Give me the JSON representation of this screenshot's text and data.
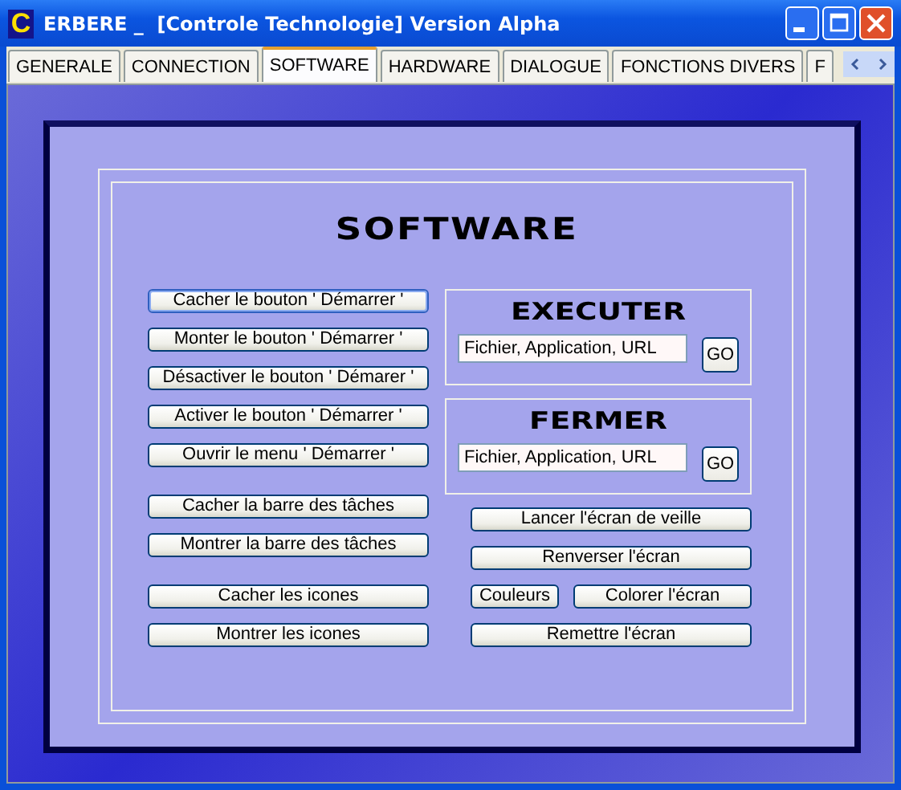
{
  "window": {
    "icon_letter": "C",
    "title": "ERBERE _  [Controle Technologie] Version Alpha"
  },
  "tabs": [
    {
      "label": "GENERALE",
      "selected": false
    },
    {
      "label": "CONNECTION",
      "selected": false
    },
    {
      "label": "SOFTWARE",
      "selected": true
    },
    {
      "label": "HARDWARE",
      "selected": false
    },
    {
      "label": "DIALOGUE",
      "selected": false
    },
    {
      "label": "FONCTIONS DIVERS",
      "selected": false
    },
    {
      "label": "F",
      "selected": false
    }
  ],
  "page": {
    "heading": "SOFTWARE",
    "left_groups": [
      [
        {
          "label": "Cacher le bouton ' Démarrer '",
          "focused": true
        },
        {
          "label": "Monter le bouton ' Démarrer '",
          "focused": false
        },
        {
          "label": "Désactiver le bouton ' Démarer '",
          "focused": false
        },
        {
          "label": "Activer le bouton ' Démarrer '",
          "focused": false
        },
        {
          "label": "Ouvrir le menu ' Démarrer '",
          "focused": false
        }
      ],
      [
        {
          "label": "Cacher la barre des tâches",
          "focused": false
        },
        {
          "label": "Montrer la barre des tâches",
          "focused": false
        }
      ],
      [
        {
          "label": "Cacher les icones",
          "focused": false
        },
        {
          "label": "Montrer les icones",
          "focused": false
        }
      ]
    ],
    "commands": [
      {
        "heading": "EXECUTER",
        "value": "Fichier, Application, URL",
        "button": "GO"
      },
      {
        "heading": "FERMER",
        "value": "Fichier, Application, URL",
        "button": "GO"
      }
    ],
    "right_rows": [
      [
        "Lancer l'écran de veille"
      ],
      [
        "Renverser l'écran"
      ],
      [
        "Couleurs",
        "Colorer l'écran"
      ],
      [
        "Remettre l'écran"
      ]
    ]
  }
}
